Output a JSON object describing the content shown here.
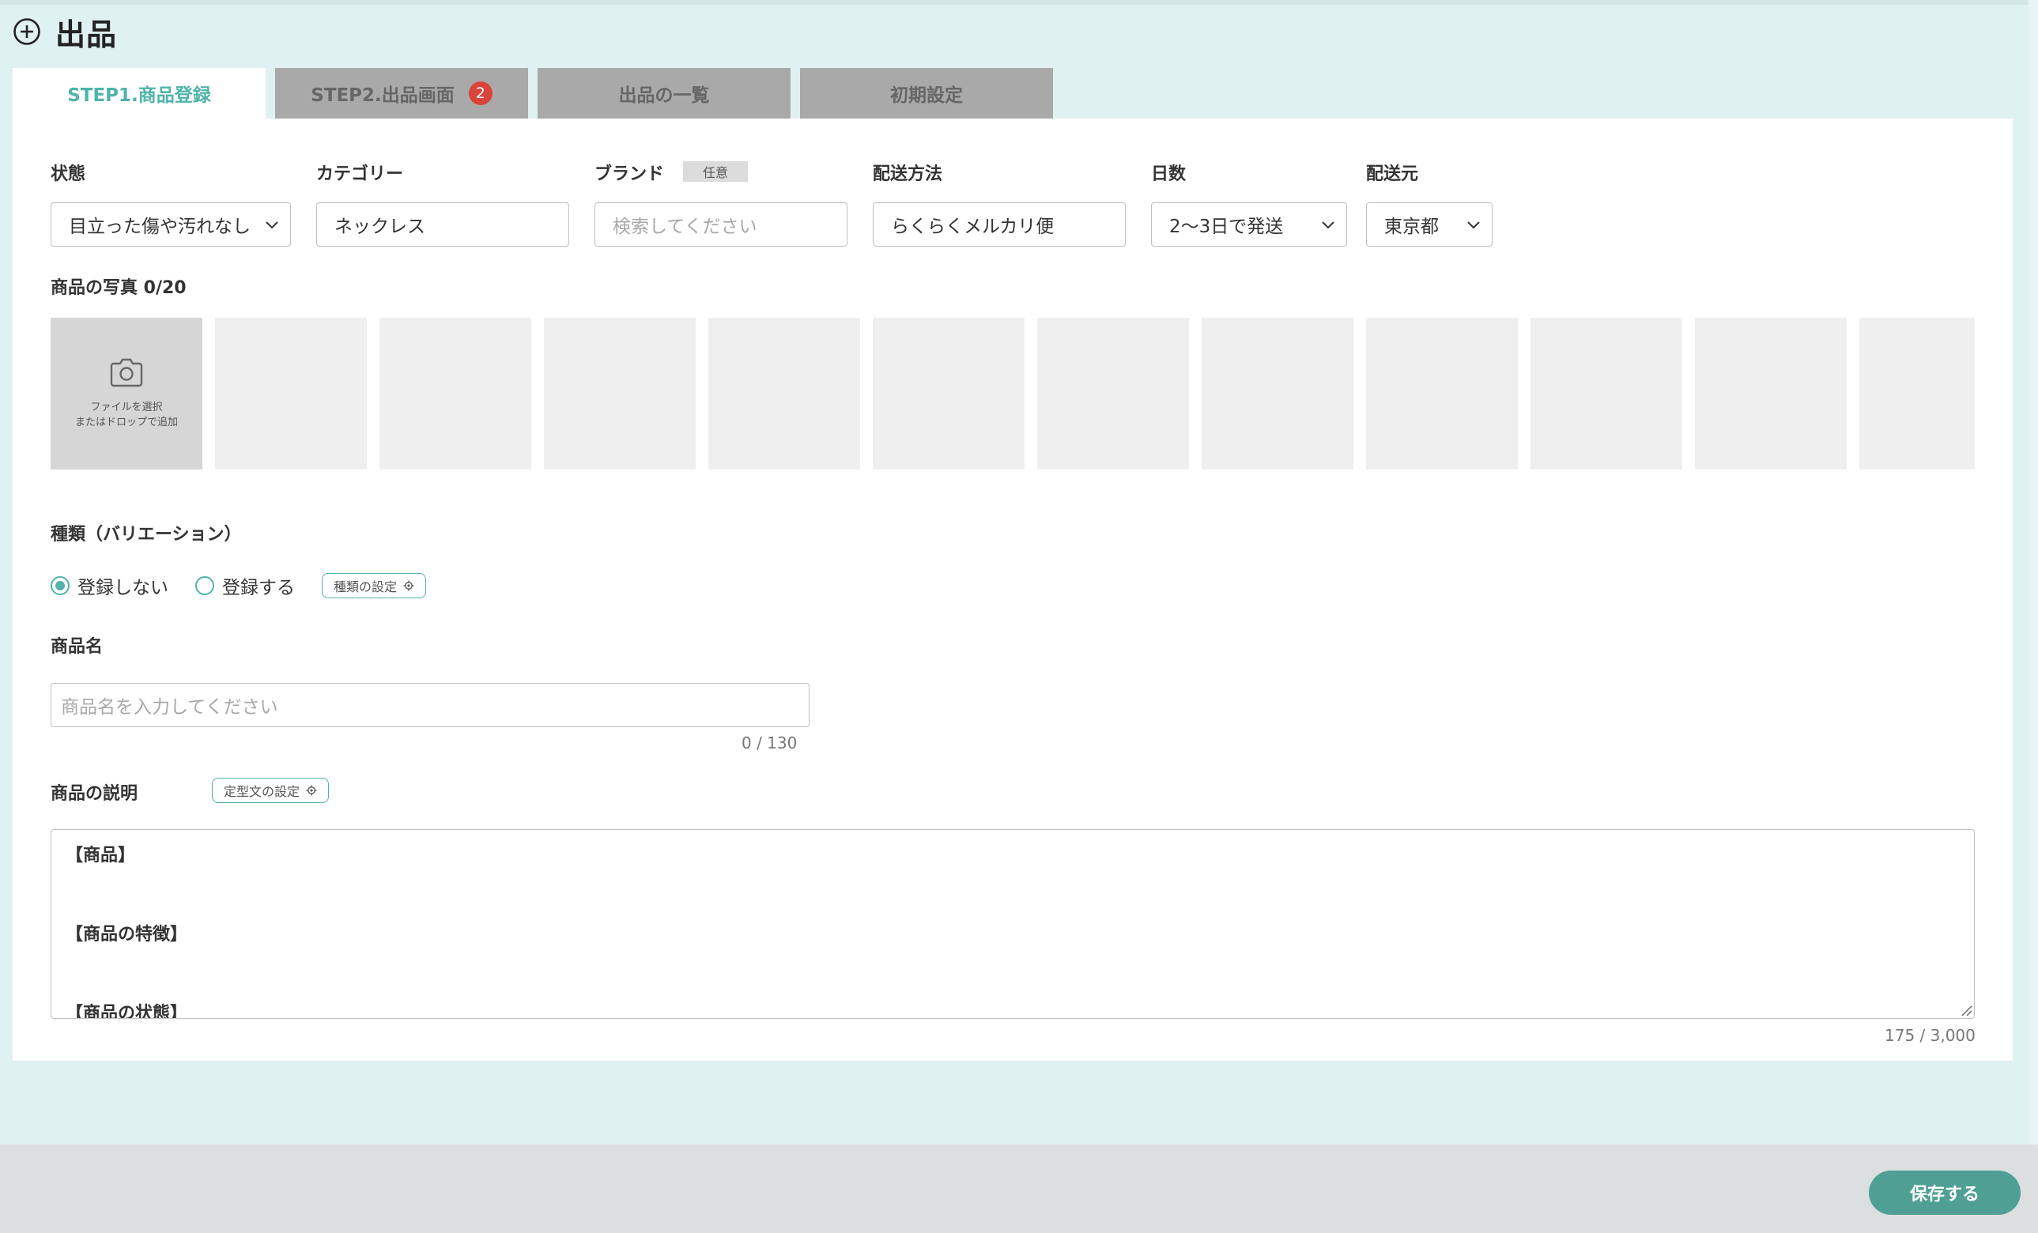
{
  "page": {
    "title": "出品"
  },
  "tabs": [
    {
      "label": "STEP1.商品登録",
      "active": true
    },
    {
      "label": "STEP2.出品画面",
      "badge": "2"
    },
    {
      "label": "出品の一覧"
    },
    {
      "label": "初期設定"
    }
  ],
  "form": {
    "condition": {
      "label": "状態",
      "value": "目立った傷や汚れなし"
    },
    "category": {
      "label": "カテゴリー",
      "value": "ネックレス"
    },
    "brand": {
      "label": "ブランド",
      "tag": "任意",
      "placeholder": "検索してください"
    },
    "shipping_method": {
      "label": "配送方法",
      "value": "らくらくメルカリ便"
    },
    "days": {
      "label": "日数",
      "value": "2〜3日で発送"
    },
    "origin": {
      "label": "配送元",
      "value": "東京都"
    }
  },
  "photos": {
    "label": "商品の写真 0/20",
    "upload_line1": "ファイルを選択",
    "upload_line2": "またはドロップで追加"
  },
  "variation": {
    "label": "種類（バリエーション）",
    "option_no": "登録しない",
    "option_yes": "登録する",
    "settings_button": "種類の設定"
  },
  "product_name": {
    "label": "商品名",
    "placeholder": "商品名を入力してください",
    "count": "0 / 130"
  },
  "description": {
    "label": "商品の説明",
    "template_button": "定型文の設定",
    "lines": [
      "【商品】",
      "",
      "【商品の特徴】",
      "",
      "【商品の状態】"
    ],
    "count": "175 / 3,000"
  },
  "footer": {
    "save_label": "保存する"
  },
  "colors": {
    "accent": "#4fb3a9",
    "save": "#4f9f94",
    "badge": "#d9453a",
    "background": "#e0f1f1"
  }
}
